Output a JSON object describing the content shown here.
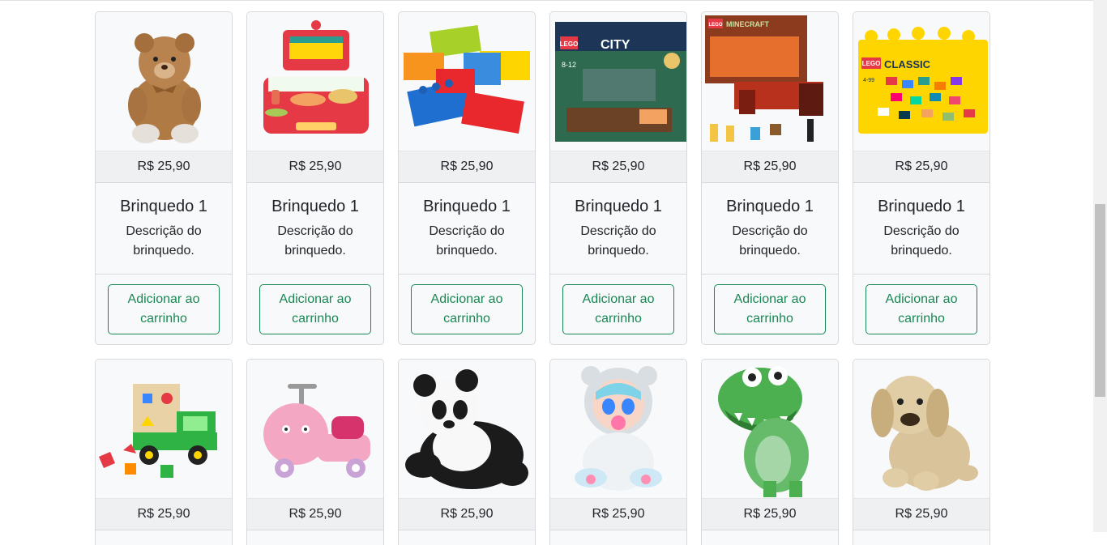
{
  "products_row1": [
    {
      "image": "teddy-bear-image",
      "price": "R$ 25,90",
      "title": "Brinquedo 1",
      "desc": "Descrição do brinquedo.",
      "button": "Adicionar ao carrinho"
    },
    {
      "image": "toy-kitchen-image",
      "price": "R$ 25,90",
      "title": "Brinquedo 1",
      "desc": "Descrição do brinquedo.",
      "button": "Adicionar ao carrinho"
    },
    {
      "image": "building-blocks-image",
      "price": "R$ 25,90",
      "title": "Brinquedo 1",
      "desc": "Descrição do brinquedo.",
      "button": "Adicionar ao carrinho"
    },
    {
      "image": "lego-city-box-image",
      "price": "R$ 25,90",
      "title": "Brinquedo 1",
      "desc": "Descrição do brinquedo.",
      "button": "Adicionar ao carrinho",
      "box_text": {
        "brand": "LEGO",
        "line": "CITY",
        "age": "8-12"
      }
    },
    {
      "image": "lego-minecraft-box-image",
      "price": "R$ 25,90",
      "title": "Brinquedo 1",
      "desc": "Descrição do brinquedo.",
      "button": "Adicionar ao carrinho",
      "box_text": {
        "brand": "LEGO",
        "line": "MINECRAFT"
      }
    },
    {
      "image": "lego-classic-box-image",
      "price": "R$ 25,90",
      "title": "Brinquedo 1",
      "desc": "Descrição do brinquedo.",
      "button": "Adicionar ao carrinho",
      "box_text": {
        "brand": "LEGO",
        "line": "CLASSIC",
        "age": "4-99"
      }
    }
  ],
  "products_row2": [
    {
      "image": "shape-sorter-truck-image",
      "price": "R$ 25,90"
    },
    {
      "image": "ride-on-car-image",
      "price": "R$ 25,90"
    },
    {
      "image": "panda-plush-image",
      "price": "R$ 25,90"
    },
    {
      "image": "baby-doll-image",
      "price": "R$ 25,90"
    },
    {
      "image": "dinosaur-rex-image",
      "price": "R$ 25,90"
    },
    {
      "image": "puppy-plush-image",
      "price": "R$ 25,90"
    }
  ],
  "colors": {
    "button_outline": "#198754",
    "card_bg": "#f8f9fa",
    "price_bg": "#eff0f1"
  }
}
